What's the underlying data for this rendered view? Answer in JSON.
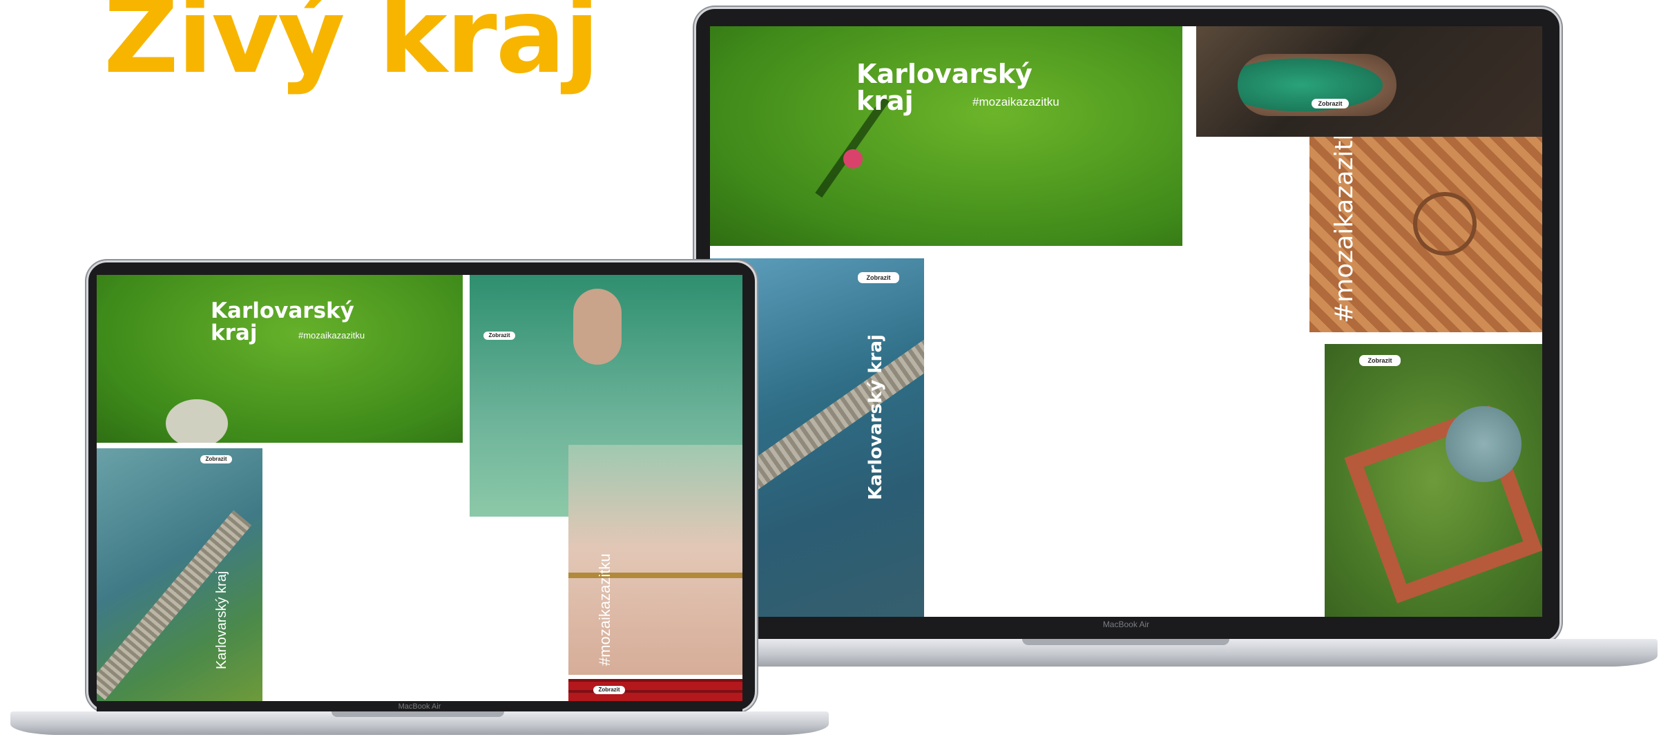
{
  "headline": {
    "text": "Živý kraj",
    "color": "#f7b500"
  },
  "device_label": "MacBook Air",
  "front_laptop": {
    "title_line1": "Karlovarský",
    "title_line2": "kraj",
    "hashtag": "#mozaikazazitku",
    "vertical_title": "Karlovarský kraj",
    "vertical_hashtag": "#mozaikazazitku",
    "badge_pool": "Zobrazit",
    "badge_rest": "Zobrazit",
    "badge_theatre": "Zobrazit"
  },
  "back_laptop": {
    "title_line1": "Karlovarský",
    "title_line2": "kraj",
    "hashtag": "#mozaikazazitku",
    "vertical_title": "Karlovarský kraj",
    "vertical_hashtag": "#mozaikazazitku",
    "badge_spa": "Zobrazit",
    "badge_river": "Zobrazit",
    "badge_castle": "Zobrazit"
  },
  "colors": {
    "grass": "#4e9a1f",
    "water": "#2f6e86",
    "theatre_red": "#b3181d",
    "tile_terracotta": "#a8663a",
    "bezel": "#1b1b1d"
  }
}
